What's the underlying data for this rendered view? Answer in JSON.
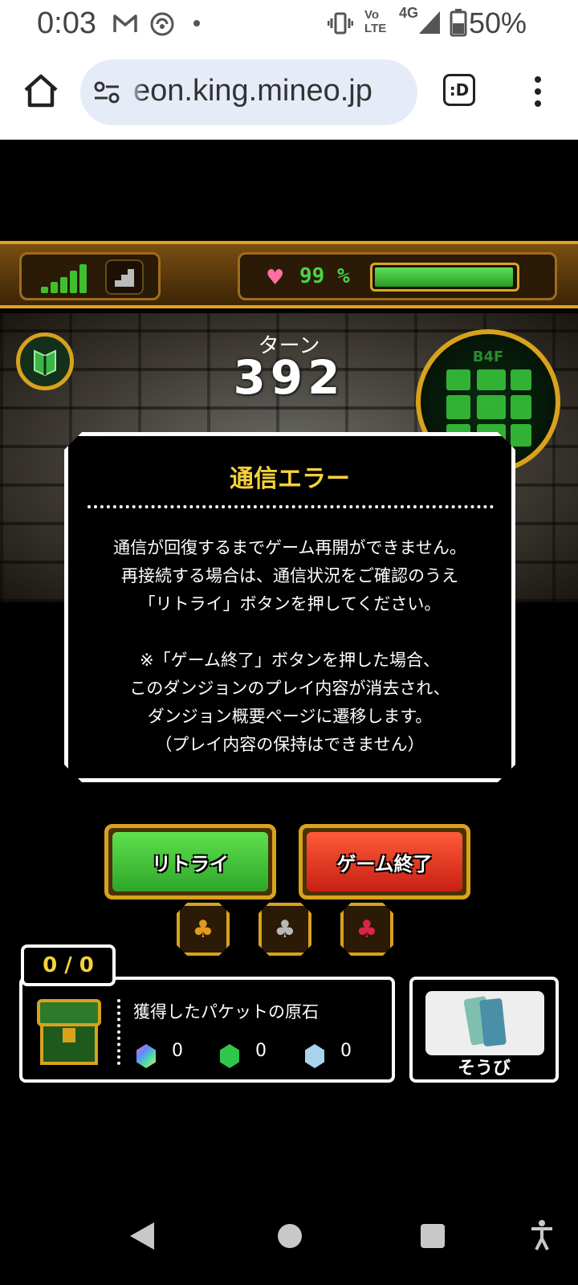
{
  "status_bar": {
    "time": "0:03",
    "carrier_small": "Vo LTE",
    "network": "4G",
    "battery": "50%"
  },
  "browser": {
    "url": "eon.king.mineo.jp",
    "tabs_label": ":D"
  },
  "hud": {
    "hp_percent": "99 %",
    "hp_value": 0.99
  },
  "game": {
    "turn_label": "ターン",
    "turn_value": "392",
    "floor": "B4F"
  },
  "dialog": {
    "title": "通信エラー",
    "lines": [
      "通信が回復するまでゲーム再開ができません。",
      "再接続する場合は、通信状況をご確認のうえ",
      "「リトライ」ボタンを押してください。",
      "",
      "※「ゲーム終了」ボタンを押した場合、",
      "このダンジョンのプレイ内容が消去され、",
      "ダンジョン概要ページに遷移します。",
      "（プレイ内容の保持はできません）"
    ]
  },
  "buttons": {
    "retry": "リトライ",
    "quit": "ゲーム終了"
  },
  "inventory": {
    "count": "0 / 0",
    "packet_title": "獲得したパケットの原石",
    "gems": [
      {
        "color": "rainbow",
        "count": "0"
      },
      {
        "color": "#2fc74a",
        "count": "0"
      },
      {
        "color": "#a9d4ee",
        "count": "0"
      }
    ],
    "equip_label": "そうび"
  },
  "colors": {
    "accent_gold": "#d8a21c",
    "title_yellow": "#f5d23a",
    "retry_green": "#3fc43a",
    "quit_red": "#e23322"
  }
}
